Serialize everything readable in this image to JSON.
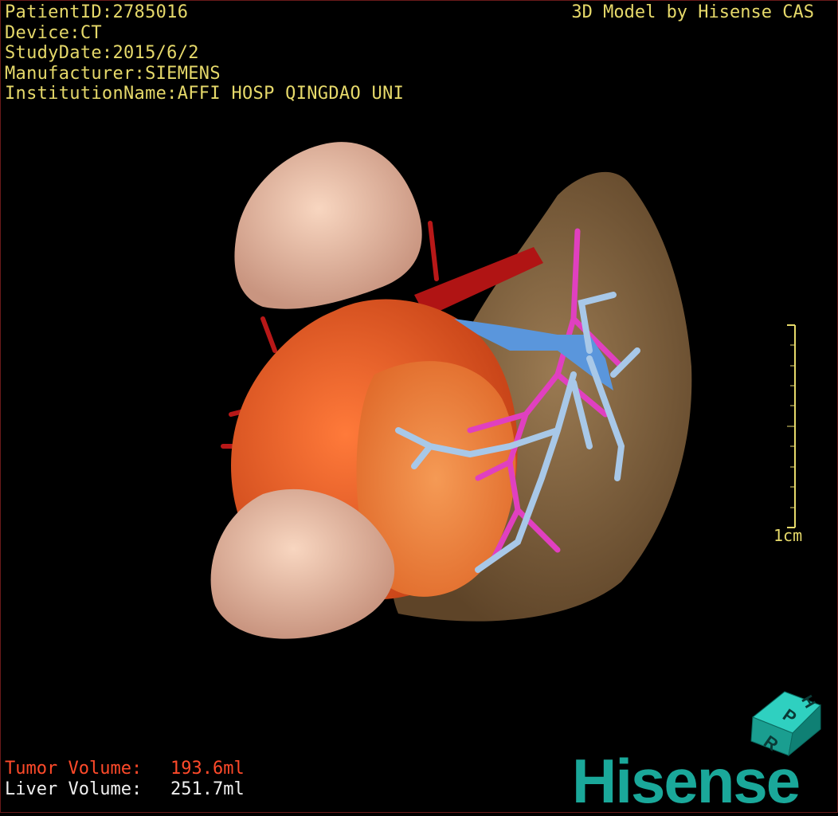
{
  "patient_info": {
    "patient_id": "PatientID:2785016",
    "device": "Device:CT",
    "study_date": "StudyDate:2015/6/2",
    "manufacturer": "Manufacturer:SIEMENS",
    "institution": "InstitutionName:AFFI HOSP QINGDAO UNI"
  },
  "header": {
    "brand_caption": "3D Model by Hisense CAS"
  },
  "scale_bar": {
    "label": "1cm"
  },
  "volumes": {
    "tumor_label": "Tumor Volume:",
    "tumor_value": "193.6ml",
    "liver_label": "Liver Volume:",
    "liver_value": "251.7ml"
  },
  "orientation_cube": {
    "faces": [
      "H",
      "P",
      "R"
    ]
  },
  "logo": {
    "text": "Hisense"
  },
  "colors": {
    "overlay_text": "#e6d96a",
    "tumor_text": "#ff4a2a",
    "liver_text": "#f0f0f0",
    "brand_teal": "#1aa89a",
    "liver_tissue": "#7a5c3a",
    "tumor_tissue": "#f06030",
    "artery": "#c01818",
    "portal_vein": "#6aa8e0",
    "hepatic_vein": "#e040c0",
    "kidney": "#f0c0a8"
  }
}
